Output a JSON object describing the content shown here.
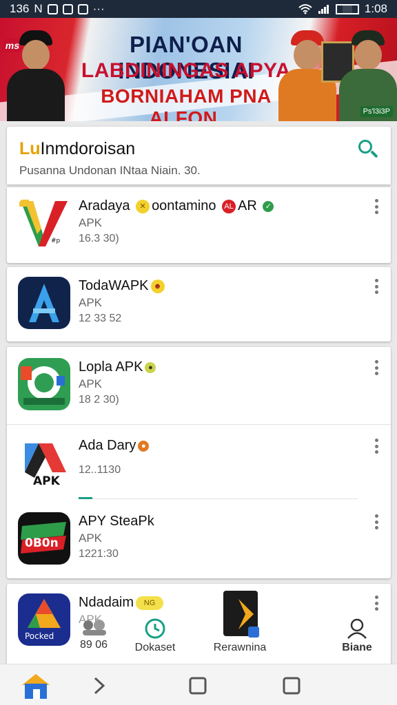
{
  "status_bar": {
    "time_left": "136",
    "carrier": "N",
    "more": "···",
    "battery": "░░",
    "time": "1:08"
  },
  "banner": {
    "line1": "PIAN'OAN INDONESIAI",
    "line2": "LABDININGAS APYA",
    "line3": "BORNIAHAM PNA ALFON.",
    "left_tag": "ms",
    "right_tag": "Ps'l3i3P"
  },
  "header": {
    "logo_mark": "Lu",
    "title": "Inmdoroisan",
    "subtitle": "Pusanna Undonan INtaa Niain. 30.",
    "search_icon": "search-icon"
  },
  "apps": [
    {
      "name": "Aradaya",
      "extra": "oontamino",
      "suffix": "AR",
      "type": "APK",
      "meta": "16.3 30)"
    },
    {
      "name": "TodaWAPK",
      "type": "APK",
      "meta": "12 33 52"
    },
    {
      "name": "Lopla APK",
      "type": "APK",
      "meta": "18 2 30)"
    },
    {
      "name": "Ada Dary",
      "type": "",
      "meta": "12..1130",
      "icon_label": "APK"
    },
    {
      "name": "APY SteaPk",
      "type": "APK",
      "meta": "1221:30",
      "icon_label": "0B0n"
    },
    {
      "name": "Ndadaim",
      "type": "APK",
      "meta": "",
      "icon_label": "Pocked"
    }
  ],
  "badges": {
    "b1": "AL",
    "b2": "NG"
  },
  "bottom_tabs": [
    {
      "label": "89 06",
      "icon": "people-icon"
    },
    {
      "label": "Dokaset",
      "icon": "clock-icon"
    },
    {
      "label": "Rerawnina",
      "icon": "app-icon"
    },
    {
      "label": "Biane",
      "icon": "profile-icon"
    }
  ],
  "nav": {
    "home_icon": "home-icon",
    "back_icon": "chevron-right-icon",
    "recent_icon": "square-icon",
    "overview_icon": "square-icon"
  },
  "colors": {
    "accent": "#16a085",
    "status_bar": "#1e2a3a",
    "banner_red": "#c8102e"
  }
}
